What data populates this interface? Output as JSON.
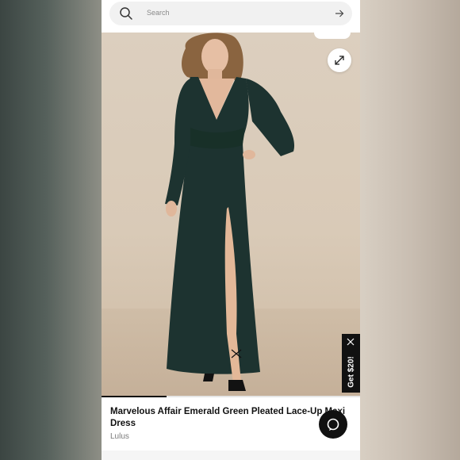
{
  "search": {
    "placeholder": "Search"
  },
  "icons": {
    "search": "search-icon",
    "submit": "arrow-right-icon",
    "expand": "expand-icon",
    "close": "close-icon",
    "chat": "chat-icon"
  },
  "promo": {
    "label": "Get $20!"
  },
  "gallery": {
    "progress": 0.25
  },
  "product": {
    "title": "Marvelous Affair Emerald Green Pleated Lace-Up Maxi Dress",
    "brand": "Lulus",
    "dress_color": "#1d3330"
  },
  "colors": {
    "accent": "#111111",
    "background_image": "#d9cab7"
  }
}
